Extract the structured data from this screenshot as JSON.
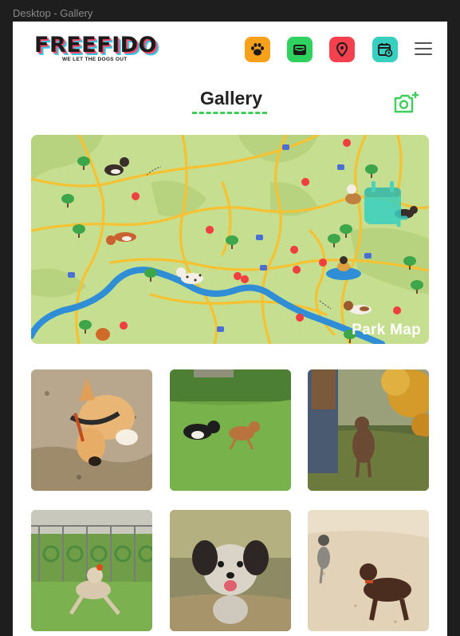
{
  "window": {
    "title": "Desktop - Gallery"
  },
  "brand": {
    "name": "FREEFIDO",
    "tagline": "WE LET THE DOGS OUT"
  },
  "nav": {
    "icons": [
      {
        "name": "paw-icon",
        "color": "#f7a11a"
      },
      {
        "name": "wallet-icon",
        "color": "#2fd15f"
      },
      {
        "name": "location-pin-icon",
        "color": "#f4404f"
      },
      {
        "name": "calendar-clock-icon",
        "color": "#37d0c0"
      }
    ]
  },
  "page": {
    "title": "Gallery"
  },
  "map": {
    "label": "Park Map"
  },
  "gallery": {
    "photos": [
      {
        "subject": "corgi digging in sand"
      },
      {
        "subject": "two dogs running on grass"
      },
      {
        "subject": "brown dog with owner under tree"
      },
      {
        "subject": "dog playing with ball in park"
      },
      {
        "subject": "shaggy terrier running"
      },
      {
        "subject": "dogs playing on sand"
      }
    ]
  },
  "colors": {
    "accent": "#3ecf5a",
    "mapGrass": "#c5de8f",
    "mapRoad": "#f6c232",
    "mapRiver": "#2f8ed6"
  }
}
